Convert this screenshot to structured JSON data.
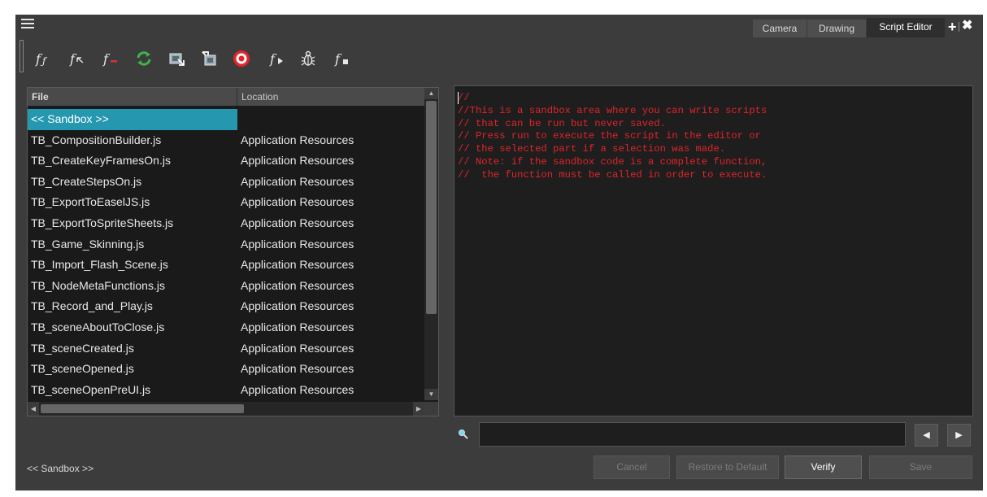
{
  "tabs": [
    {
      "label": "Camera",
      "active": false
    },
    {
      "label": "Drawing",
      "active": false
    },
    {
      "label": "Script Editor",
      "active": true
    }
  ],
  "tab_controls": {
    "add": "+",
    "close": "✖"
  },
  "toolbar": {
    "icons": [
      "function-italic-icon",
      "function-with-arrow-icon",
      "function-red-dash-icon",
      "refresh-green-icon",
      "import-script-icon",
      "export-script-icon",
      "target-red-icon",
      "function-run-icon",
      "debug-bug-icon",
      "function-stop-icon"
    ]
  },
  "file_table": {
    "columns": [
      "File",
      "Location"
    ],
    "rows": [
      {
        "file": "<< Sandbox >>",
        "location": "",
        "selected": true
      },
      {
        "file": "TB_CompositionBuilder.js",
        "location": "Application Resources"
      },
      {
        "file": "TB_CreateKeyFramesOn.js",
        "location": "Application Resources"
      },
      {
        "file": "TB_CreateStepsOn.js",
        "location": "Application Resources"
      },
      {
        "file": "TB_ExportToEaselJS.js",
        "location": "Application Resources"
      },
      {
        "file": "TB_ExportToSpriteSheets.js",
        "location": "Application Resources"
      },
      {
        "file": "TB_Game_Skinning.js",
        "location": "Application Resources"
      },
      {
        "file": "TB_Import_Flash_Scene.js",
        "location": "Application Resources"
      },
      {
        "file": "TB_NodeMetaFunctions.js",
        "location": "Application Resources"
      },
      {
        "file": "TB_Record_and_Play.js",
        "location": "Application Resources"
      },
      {
        "file": "TB_sceneAboutToClose.js",
        "location": "Application Resources"
      },
      {
        "file": "TB_sceneCreated.js",
        "location": "Application Resources"
      },
      {
        "file": "TB_sceneOpened.js",
        "location": "Application Resources"
      },
      {
        "file": "TB_sceneOpenPreUI.js",
        "location": "Application Resources"
      }
    ]
  },
  "editor": {
    "lines": [
      "//",
      "//This is a sandbox area where you can write scripts",
      "// that can be run but never saved.",
      "// Press run to execute the script in the editor or",
      "// the selected part if a selection was made.",
      "// Note: if the sandbox code is a complete function,",
      "//  the function must be called in order to execute."
    ],
    "comment_color": "#e0242a"
  },
  "search": {
    "value": ""
  },
  "nav": {
    "prev": "◀",
    "next": "▶"
  },
  "footer": {
    "current_script": "<< Sandbox >>",
    "buttons": {
      "cancel": "Cancel",
      "restore": "Restore to Default",
      "verify": "Verify",
      "save": "Save"
    }
  },
  "colors": {
    "selection": "#2597ae",
    "panel": "#3c3c3c"
  }
}
